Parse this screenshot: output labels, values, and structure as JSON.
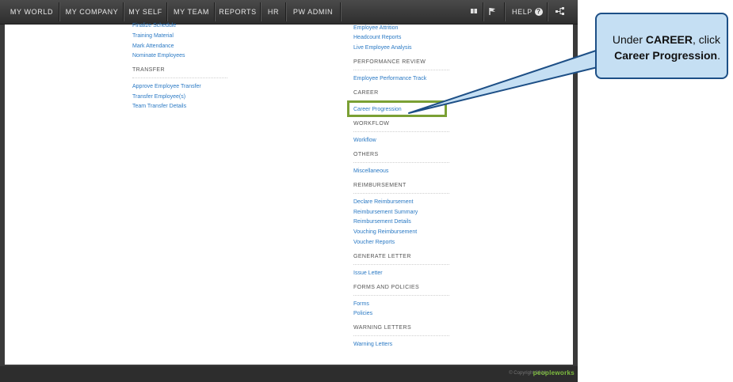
{
  "nav": {
    "items": [
      "MY WORLD",
      "MY COMPANY",
      "MY SELF",
      "MY TEAM",
      "REPORTS",
      "HR",
      "PW ADMIN"
    ],
    "help_label": "HELP",
    "help_icon": "question-circle-icon",
    "tool_icons": [
      "book-icon",
      "flag-icon",
      "tree-icon"
    ]
  },
  "left_column": {
    "links_top": [
      "Finalize Schedule",
      "Training Material",
      "Mark Attendance",
      "Nominate Employees"
    ],
    "transfer_heading": "TRANSFER",
    "transfer_links": [
      "Approve Employee Transfer",
      "Transfer Employee(s)",
      "Team Transfer Details"
    ]
  },
  "right_column": {
    "links_top": [
      "Employee Attrition",
      "Headcount Reports",
      "Live Employee Analysis"
    ],
    "sections": [
      {
        "heading": "PERFORMANCE REVIEW",
        "links": [
          "Employee Performance Track"
        ]
      },
      {
        "heading": "CAREER",
        "links": [
          "Career Progression"
        ]
      },
      {
        "heading": "WORKFLOW",
        "links": [
          "Workflow"
        ]
      },
      {
        "heading": "OTHERS",
        "links": [
          "Miscellaneous"
        ]
      },
      {
        "heading": "REIMBURSEMENT",
        "links": [
          "Declare Reimbursement",
          "Reimbursement Summary",
          "Reimbursement Details",
          "Vouching Reimbursement",
          "Voucher Reports"
        ]
      },
      {
        "heading": "GENERATE LETTER",
        "links": [
          "Issue Letter"
        ]
      },
      {
        "heading": "FORMS AND POLICIES",
        "links": [
          "Forms",
          "Policies"
        ]
      },
      {
        "heading": "WARNING LETTERS",
        "links": [
          "Warning Letters"
        ]
      }
    ]
  },
  "footer": {
    "copyright": "© Copyright 2014",
    "logo": "peopleworks"
  },
  "callout": {
    "prefix": "Under ",
    "section": "CAREER",
    "middle": ", click",
    "target": "Career Progression",
    "suffix": "."
  },
  "colors": {
    "link": "#2a79c4",
    "highlight": "#7aa034",
    "callout_fill": "#c5dff3",
    "callout_border": "#1d4f86"
  }
}
